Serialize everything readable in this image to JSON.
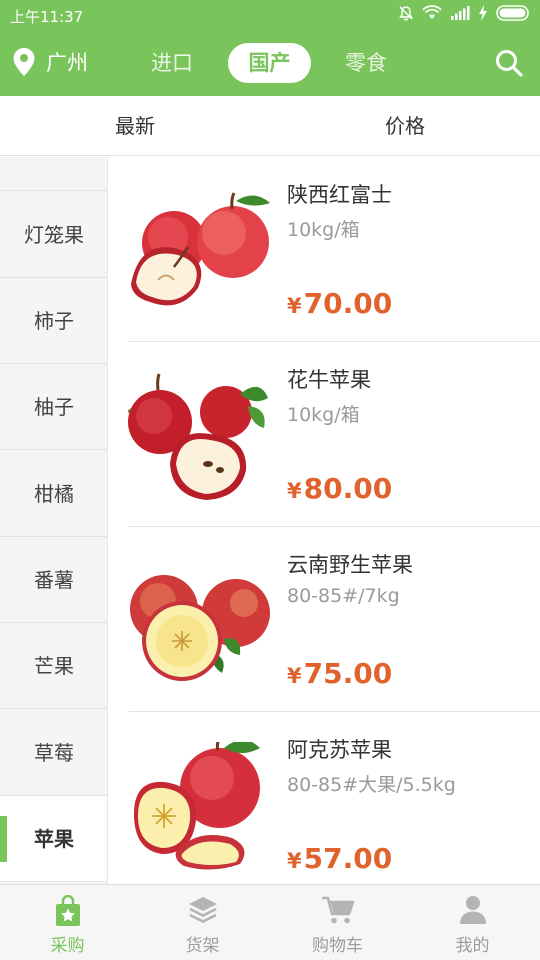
{
  "status_bar": {
    "time": "上午11:37"
  },
  "header": {
    "location": "广州",
    "tabs": [
      {
        "label": "进口",
        "active": false
      },
      {
        "label": "国产",
        "active": true
      },
      {
        "label": "零食",
        "active": false
      }
    ],
    "icons": [
      "location-pin-icon",
      "search-icon"
    ]
  },
  "sort": {
    "newest": "最新",
    "price": "价格"
  },
  "categories": [
    {
      "label": "灯笼果",
      "active": false
    },
    {
      "label": "柿子",
      "active": false
    },
    {
      "label": "柚子",
      "active": false
    },
    {
      "label": "柑橘",
      "active": false
    },
    {
      "label": "番薯",
      "active": false
    },
    {
      "label": "芒果",
      "active": false
    },
    {
      "label": "草莓",
      "active": false
    },
    {
      "label": "苹果",
      "active": true
    }
  ],
  "products": [
    {
      "name": "陕西红富士",
      "spec": "10kg/箱",
      "currency": "¥",
      "price": "70.00"
    },
    {
      "name": "花牛苹果",
      "spec": "10kg/箱",
      "currency": "¥",
      "price": "80.00"
    },
    {
      "name": "云南野生苹果",
      "spec": "80-85#/7kg",
      "currency": "¥",
      "price": "75.00"
    },
    {
      "name": "阿克苏苹果",
      "spec": "80-85#大果/5.5kg",
      "currency": "¥",
      "price": "57.00"
    }
  ],
  "tabbar": [
    {
      "label": "采购",
      "icon": "shopping-bag-star-icon",
      "active": true
    },
    {
      "label": "货架",
      "icon": "layers-icon",
      "active": false
    },
    {
      "label": "购物车",
      "icon": "cart-icon",
      "active": false
    },
    {
      "label": "我的",
      "icon": "person-icon",
      "active": false
    }
  ],
  "colors": {
    "brand": "#7ac45c",
    "price": "#e0622d"
  }
}
